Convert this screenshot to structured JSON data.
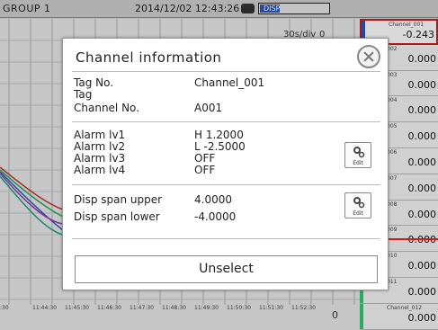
{
  "topbar": {
    "group": "GROUP 1",
    "datetime": "2014/12/02 12:43:26",
    "disp_label": "DISP"
  },
  "trend": {
    "div_label": "30s/div",
    "scale_zero": "0",
    "time_ticks": [
      ":30",
      "11:44:30",
      "11:45:30",
      "11:46:30",
      "11:47:30",
      "11:48:30",
      "11:49:30",
      "11:50:30",
      "11:51:30",
      "11:52:30"
    ],
    "scale_zero_bottom": "0"
  },
  "channels": [
    {
      "name": "Channel_001",
      "value": "-0.243",
      "color": "#2a56c6"
    },
    {
      "name": "002",
      "value": "0.000",
      "color": "#c0392b"
    },
    {
      "name": "003",
      "value": "0.000",
      "color": "#27ae60"
    },
    {
      "name": "004",
      "value": "0.000",
      "color": "#2980b9"
    },
    {
      "name": "005",
      "value": "0.000",
      "color": "#8e44ad"
    },
    {
      "name": "006",
      "value": "0.000",
      "color": "#16a085"
    },
    {
      "name": "007",
      "value": "0.000",
      "color": "#7f8c8d"
    },
    {
      "name": "008",
      "value": "0.000",
      "color": "#6d4c41"
    },
    {
      "name": "009",
      "value": "0.000",
      "color": "#2c3e50"
    },
    {
      "name": "010",
      "value": "0.000",
      "color": "#5d6d7e"
    },
    {
      "name": "011",
      "value": "0.000",
      "color": "#2ecc71"
    },
    {
      "name": "Channel_012",
      "value": "0.000",
      "color": "#2ecc71"
    }
  ],
  "dialog": {
    "title": "Channel information",
    "tag_no_label": "Tag No.",
    "tag_no_value": "Channel_001",
    "tag_label": "Tag",
    "channel_no_label": "Channel No.",
    "channel_no_value": "A001",
    "alarm_lv1_label": "Alarm lv1",
    "alarm_lv1_value": "H 1.2000",
    "alarm_lv2_label": "Alarm lv2",
    "alarm_lv2_value": "L -2.5000",
    "alarm_lv3_label": "Alarm lv3",
    "alarm_lv3_value": "OFF",
    "alarm_lv4_label": "Alarm lv4",
    "alarm_lv4_value": "OFF",
    "span_upper_label": "Disp span upper",
    "span_upper_value": "4.0000",
    "span_lower_label": "Disp span lower",
    "span_lower_value": "-4.0000",
    "edit_label": "Edit",
    "unselect_label": "Unselect"
  }
}
